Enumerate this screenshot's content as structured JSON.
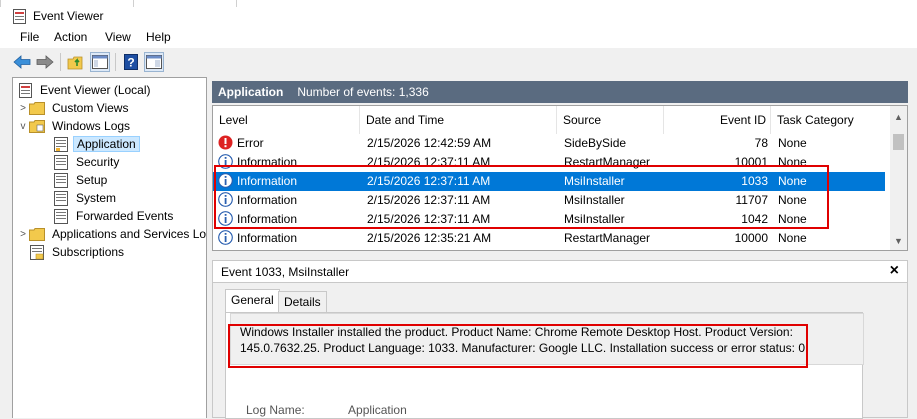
{
  "window": {
    "title": "Event Viewer"
  },
  "menu": [
    "File",
    "Action",
    "View",
    "Help"
  ],
  "toolbar": {
    "buttons": [
      "back-icon",
      "forward-icon",
      "up-folder-icon",
      "console-tree-icon",
      "help-icon",
      "show-hide-icon"
    ]
  },
  "tree": {
    "items": [
      {
        "label": "Event Viewer (Local)",
        "icon": "event-viewer-icon",
        "expander": ""
      },
      {
        "label": "Custom Views",
        "icon": "folder-icon",
        "expander": ">"
      },
      {
        "label": "Windows Logs",
        "icon": "folder-icon",
        "expander": "v"
      },
      {
        "label": "Application",
        "icon": "log-icon",
        "expander": "",
        "selected": true
      },
      {
        "label": "Security",
        "icon": "log-icon",
        "expander": ""
      },
      {
        "label": "Setup",
        "icon": "log-icon",
        "expander": ""
      },
      {
        "label": "System",
        "icon": "log-icon",
        "expander": ""
      },
      {
        "label": "Forwarded Events",
        "icon": "log-icon",
        "expander": ""
      },
      {
        "label": "Applications and Services Lo",
        "icon": "folder-icon",
        "expander": ">"
      },
      {
        "label": "Subscriptions",
        "icon": "subscriptions-icon",
        "expander": ""
      }
    ]
  },
  "log_header": {
    "title": "Application",
    "count": "Number of events: 1,336"
  },
  "columns": [
    "Level",
    "Date and Time",
    "Source",
    "Event ID",
    "Task Category"
  ],
  "events": [
    {
      "level": "Error",
      "datetime": "2/15/2026 12:42:59 AM",
      "source": "SideBySide",
      "event_id": "78",
      "category": "None"
    },
    {
      "level": "Information",
      "datetime": "2/15/2026 12:37:11 AM",
      "source": "RestartManager",
      "event_id": "10001",
      "category": "None"
    },
    {
      "level": "Information",
      "datetime": "2/15/2026 12:37:11 AM",
      "source": "MsiInstaller",
      "event_id": "1033",
      "category": "None",
      "selected": true
    },
    {
      "level": "Information",
      "datetime": "2/15/2026 12:37:11 AM",
      "source": "MsiInstaller",
      "event_id": "11707",
      "category": "None"
    },
    {
      "level": "Information",
      "datetime": "2/15/2026 12:37:11 AM",
      "source": "MsiInstaller",
      "event_id": "1042",
      "category": "None"
    },
    {
      "level": "Information",
      "datetime": "2/15/2026 12:35:21 AM",
      "source": "RestartManager",
      "event_id": "10000",
      "category": "None"
    }
  ],
  "detail": {
    "title": "Event 1033, MsiInstaller",
    "close": "×",
    "tabs": [
      "General",
      "Details"
    ],
    "description_line1": "Windows Installer installed the product. Product Name: Chrome Remote Desktop Host. Product Version:",
    "description_line2": "145.0.7632.25. Product Language: 1033. Manufacturer: Google LLC. Installation success or error status: 0.",
    "log_name_label": "Log Name:",
    "log_name_value": "Application"
  },
  "colors": {
    "selection": "#0078d7",
    "header": "#5a6b80",
    "annotation": "#e00000"
  }
}
